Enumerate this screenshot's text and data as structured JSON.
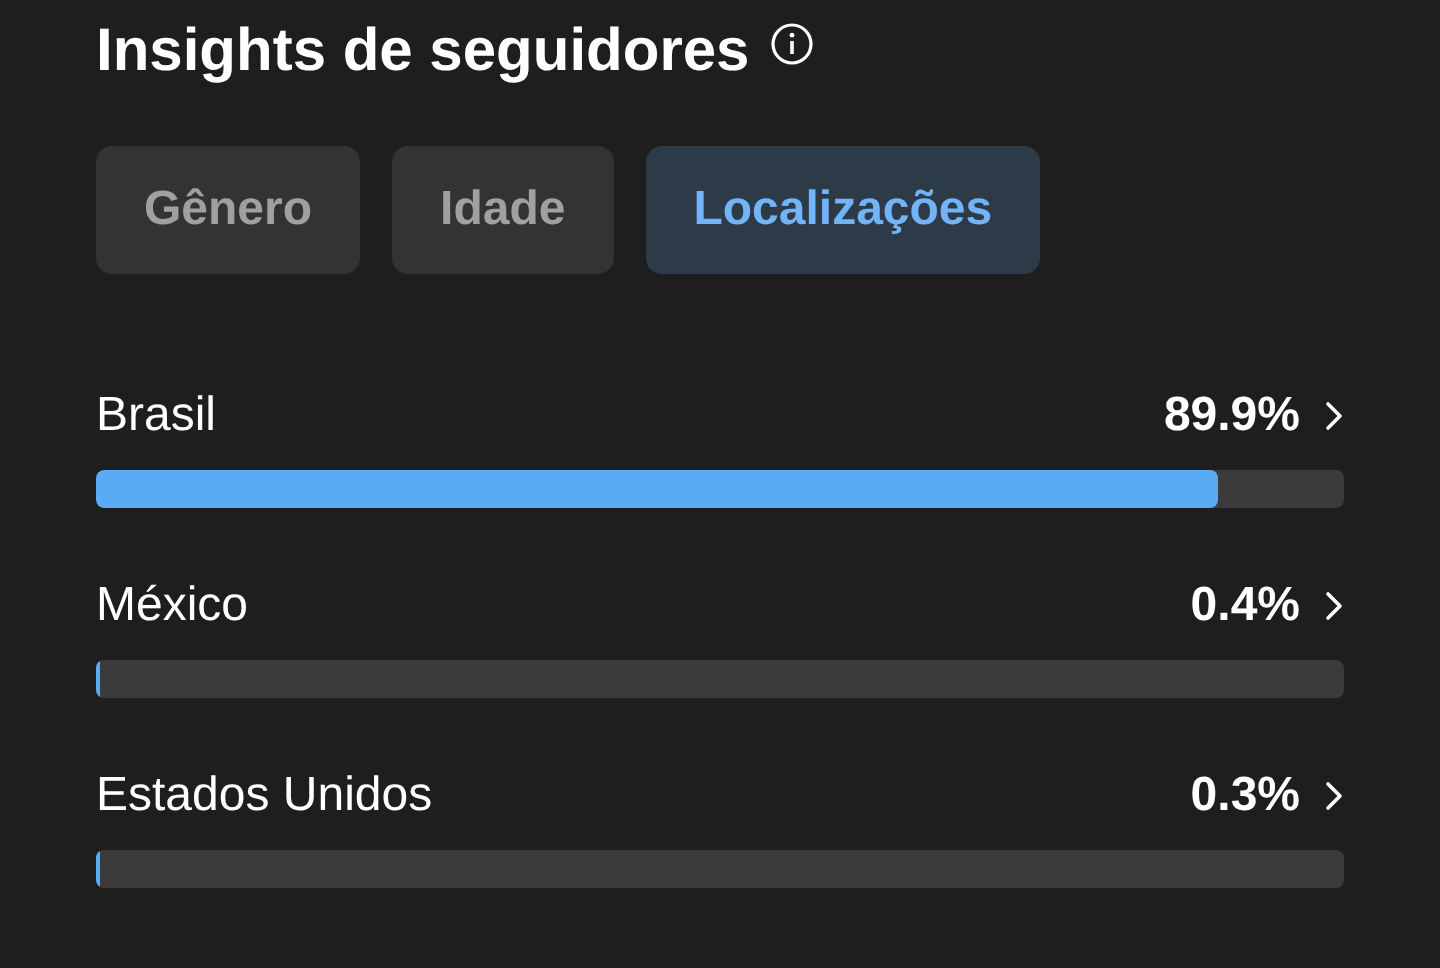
{
  "title": "Insights de seguidores",
  "tabs": [
    {
      "label": "Gênero",
      "selected": false
    },
    {
      "label": "Idade",
      "selected": false
    },
    {
      "label": "Localizações",
      "selected": true
    }
  ],
  "locations": [
    {
      "name": "Brasil",
      "percent": "89.9%",
      "level": 0.899
    },
    {
      "name": "México",
      "percent": "0.4%",
      "level": 0.004
    },
    {
      "name": "Estados Unidos",
      "percent": "0.3%",
      "level": 0.003
    }
  ]
}
